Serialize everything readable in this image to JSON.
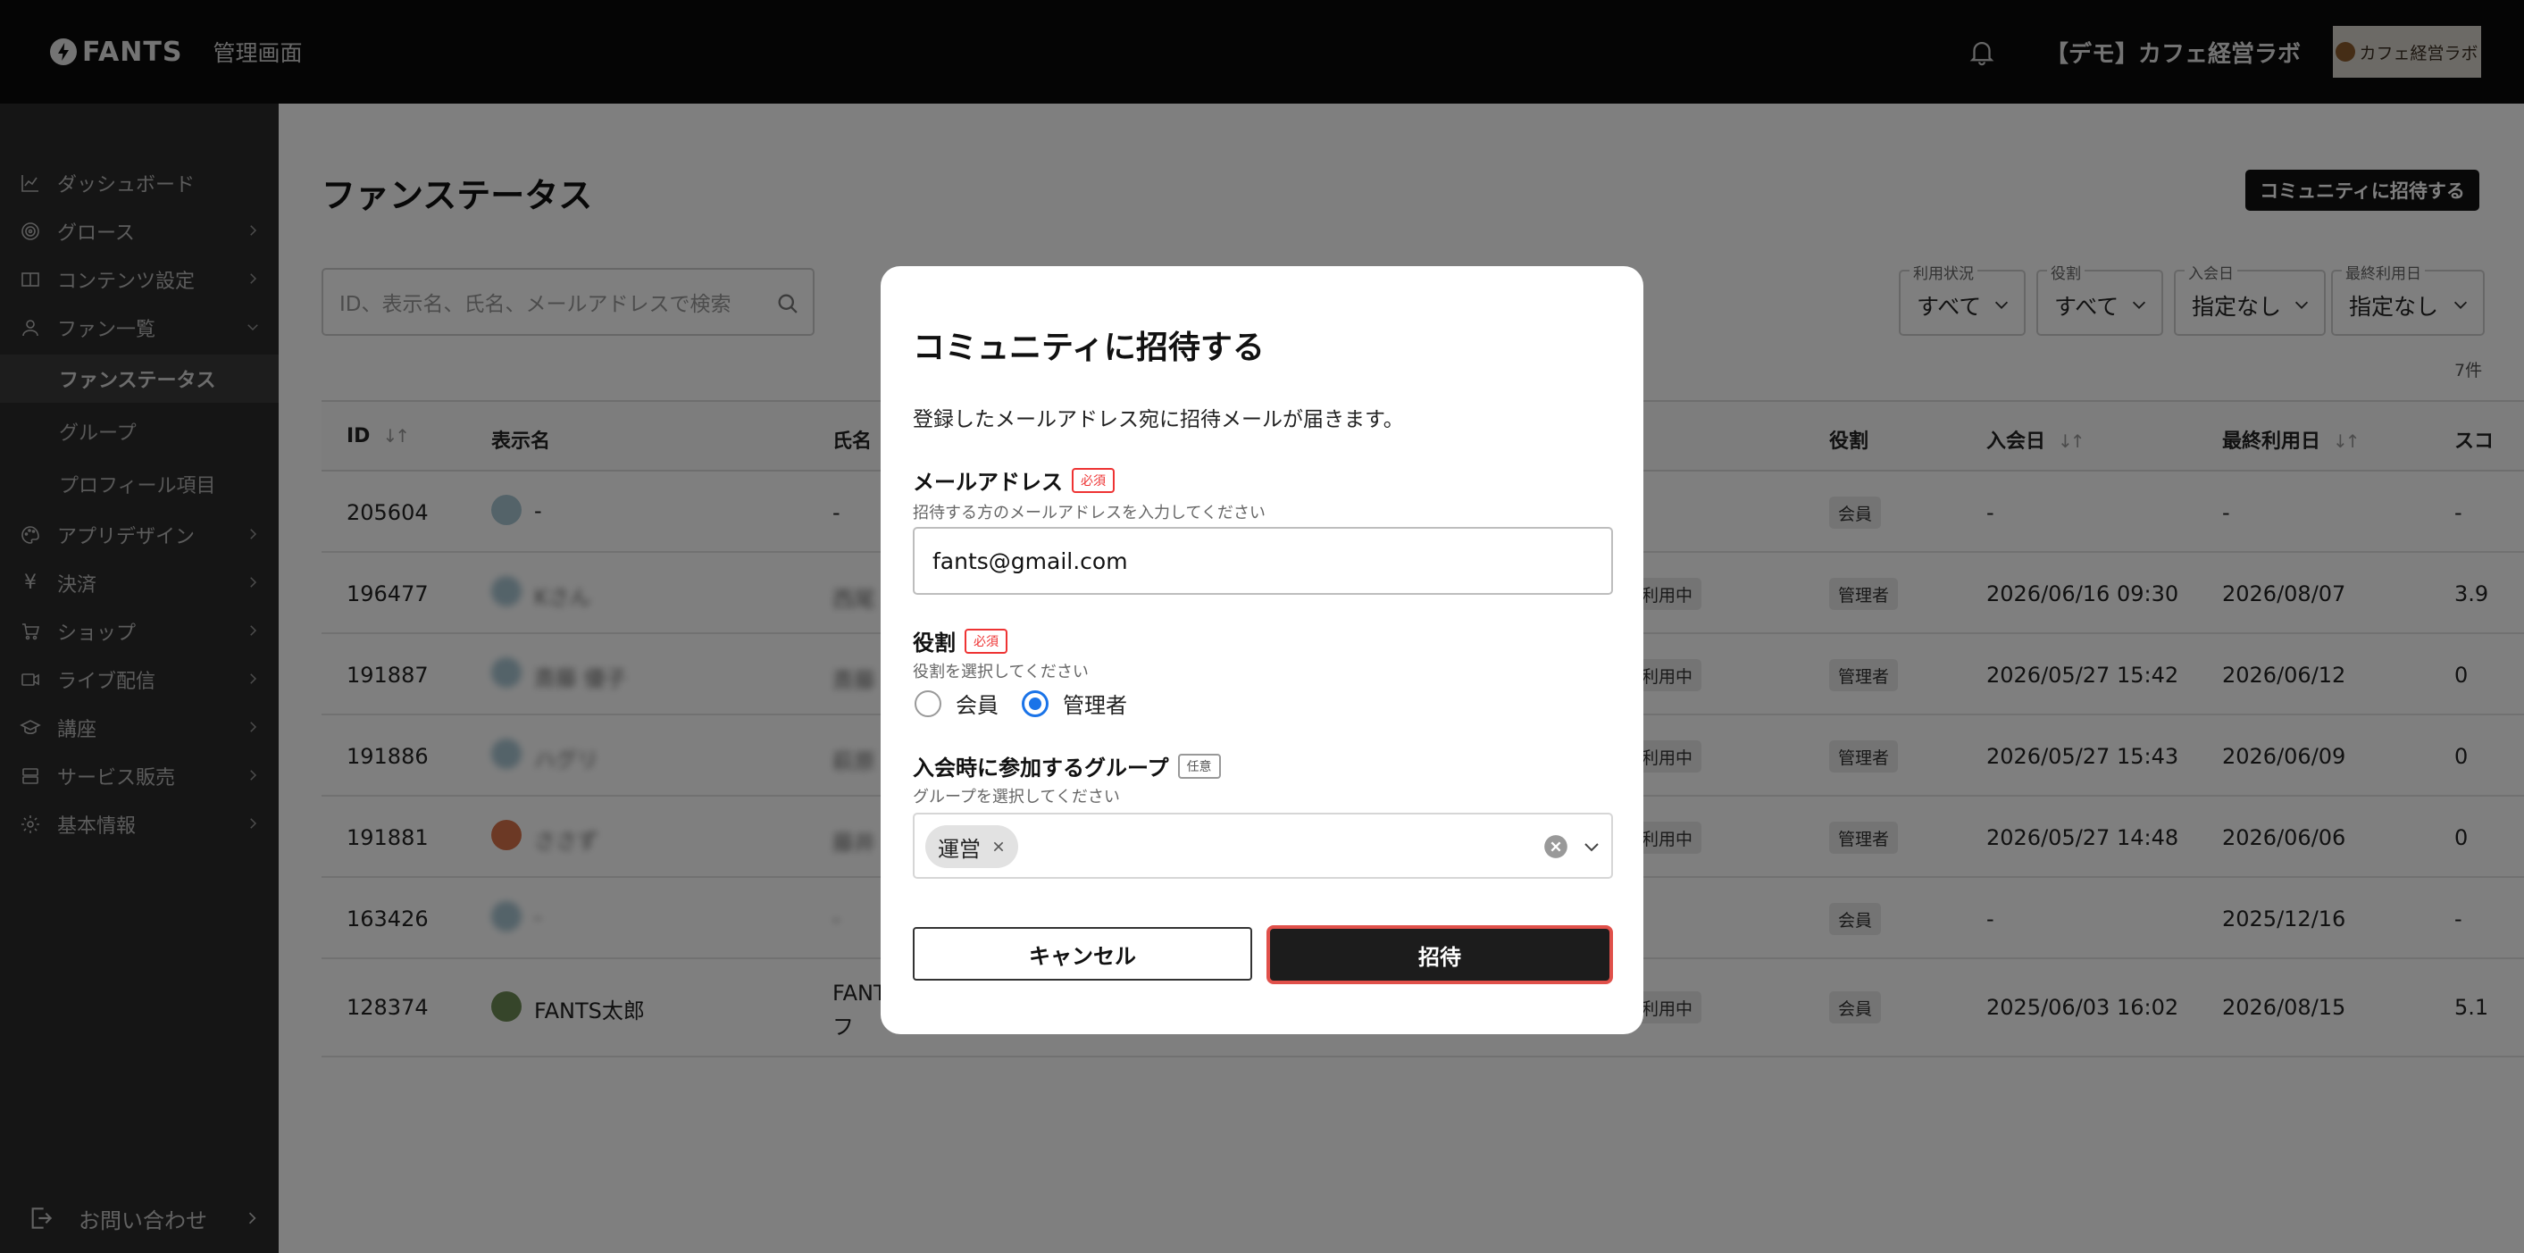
{
  "header": {
    "logo": "FANTS",
    "admin_label": "管理画面",
    "org_name": "【デモ】カフェ経営ラボ",
    "org_avatar_text": "カフェ経営ラボ"
  },
  "sidebar": {
    "items": [
      {
        "label": "ダッシュボード",
        "icon": "chart-line-icon"
      },
      {
        "label": "グロース",
        "icon": "target-icon"
      },
      {
        "label": "コンテンツ設定",
        "icon": "book-icon"
      },
      {
        "label": "ファン一覧",
        "icon": "user-icon"
      },
      {
        "label": "アプリデザイン",
        "icon": "palette-icon"
      },
      {
        "label": "決済",
        "icon": "yen-icon"
      },
      {
        "label": "ショップ",
        "icon": "cart-icon"
      },
      {
        "label": "ライブ配信",
        "icon": "video-icon"
      },
      {
        "label": "講座",
        "icon": "graduation-cap-icon"
      },
      {
        "label": "サービス販売",
        "icon": "database-icon"
      },
      {
        "label": "基本情報",
        "icon": "gear-icon"
      }
    ],
    "sub_items": [
      "ファンステータス",
      "グループ",
      "プロフィール項目"
    ],
    "contact": "お問い合わせ"
  },
  "main": {
    "title": "ファンステータス",
    "invite_button": "コミュニティに招待する",
    "search_placeholder": "ID、表示名、氏名、メールアドレスで検索",
    "filters": [
      {
        "label": "利用状況",
        "value": "すべて"
      },
      {
        "label": "役割",
        "value": "すべて"
      },
      {
        "label": "入会日",
        "value": "指定なし"
      },
      {
        "label": "最終利用日",
        "value": "指定なし"
      }
    ],
    "count": "7件",
    "columns": {
      "id": "ID",
      "display_name": "表示名",
      "name": "氏名",
      "role": "役割",
      "joined": "入会日",
      "last_used": "最終利用日",
      "score": "スコ"
    },
    "rows": [
      {
        "id": "205604",
        "display": "-",
        "name": "-",
        "status": "",
        "role": "会員",
        "joined": "-",
        "last": "-",
        "score": "-"
      },
      {
        "id": "196477",
        "display": "Kさん",
        "name": "西尾",
        "status": "利用中",
        "role": "管理者",
        "joined": "2026/06/16 09:30",
        "last": "2026/08/07",
        "score": "3.9"
      },
      {
        "id": "191887",
        "display": "斎藤 優子",
        "name": "斎藤",
        "status": "利用中",
        "role": "管理者",
        "joined": "2026/05/27 15:42",
        "last": "2026/06/12",
        "score": "0"
      },
      {
        "id": "191886",
        "display": "ハグリ",
        "name": "萩原",
        "status": "利用中",
        "role": "管理者",
        "joined": "2026/05/27 15:43",
        "last": "2026/06/09",
        "score": "0"
      },
      {
        "id": "191881",
        "display": "ささず",
        "name": "藤井",
        "status": "利用中",
        "role": "管理者",
        "joined": "2026/05/27 14:48",
        "last": "2026/06/06",
        "score": "0"
      },
      {
        "id": "163426",
        "display": "-",
        "name": "-",
        "status": "",
        "role": "会員",
        "joined": "-",
        "last": "2025/12/16",
        "score": "-"
      },
      {
        "id": "128374",
        "display": "FANTS太郎",
        "name": "FANT",
        "name2": "フ",
        "status": "利用中",
        "role": "会員",
        "joined": "2025/06/03 16:02",
        "last": "2026/08/15",
        "score": "5.1"
      }
    ]
  },
  "modal": {
    "title": "コミュニティに招待する",
    "description": "登録したメールアドレス宛に招待メールが届きます。",
    "email_label": "メールアドレス",
    "required": "必須",
    "email_hint": "招待する方のメールアドレスを入力してください",
    "email_value": "fants@gmail.com",
    "role_label": "役割",
    "role_hint": "役割を選択してください",
    "role_options": [
      "会員",
      "管理者"
    ],
    "role_selected": "管理者",
    "group_label": "入会時に参加するグループ",
    "optional": "任意",
    "group_hint": "グループを選択してください",
    "group_chip": "運営",
    "cancel": "キャンセル",
    "submit": "招待"
  }
}
